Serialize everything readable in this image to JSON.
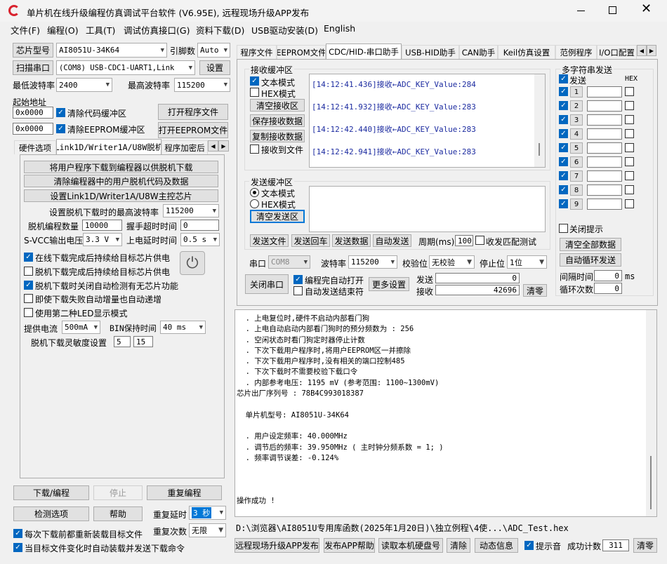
{
  "window": {
    "title": "单片机在线升级编程仿真调试平台软件 (V6.95E), 远程现场升级APP发布",
    "minimize_icon": "minimize-icon",
    "maximize_icon": "maximize-icon",
    "close_icon": "close-icon"
  },
  "menu": [
    "文件(F)",
    "编程(O)",
    "工具(T)",
    "调试仿真接口(G)",
    "资料下载(D)",
    "USB驱动安装(D)",
    "English"
  ],
  "left": {
    "chip_type_button": "芯片型号",
    "chip_type_value": "AI8051U-34K64",
    "pin_count_label": "引脚数",
    "pin_count_value": "Auto",
    "scan_port_button": "扫描串口",
    "port_value": "(COM8) USB-CDC1-UART1,Link",
    "settings_button": "设置",
    "min_baud_label": "最低波特率",
    "min_baud_value": "2400",
    "max_baud_label": "最高波特率",
    "max_baud_value": "115200",
    "start_addr_label": "起始地址",
    "code_addr_value": "0x0000",
    "clear_code_label": "清除代码缓冲区",
    "open_program_button": "打开程序文件",
    "eeprom_addr_value": "0x0000",
    "clear_eeprom_label": "清除EEPROM缓冲区",
    "open_eeprom_button": "打开EEPROM文件",
    "tabs": [
      "硬件选项",
      "Link1D/Writer1A/U8W脱机",
      "程序加密后"
    ],
    "offline": {
      "btn1": "将用户程序下载到编程器以供脱机下载",
      "btn2": "清除编程器中的用户脱机代码及数据",
      "btn3": "设置Link1D/Writer1A/U8W主控芯片",
      "max_baud_label": "设置脱机下载时的最高波特率",
      "max_baud_value": "115200",
      "count_label": "脱机编程数量",
      "count_value": "10000",
      "handshake_label": "握手超时时间",
      "handshake_value": "0",
      "svcc_label": "S-VCC输出电压",
      "svcc_value": "3.3 V",
      "power_delay_label": "上电延时时间",
      "power_delay_value": "0.5 s",
      "cb1": "在线下载完成后持续给目标芯片供电",
      "cb2": "脱机下载完成后持续给目标芯片供电",
      "cb3": "脱机下载时关闭自动检测有无芯片功能",
      "cb4": "即使下载失败自动增量也自动递增",
      "cb5": "使用第二种LED显示模式",
      "supply_label": "提供电流",
      "supply_value": "500mA",
      "bin_hold_label": "BIN保持时间",
      "bin_hold_value": "40 ms",
      "sensitivity_label": "脱机下载灵敏度设置",
      "sens1": "5",
      "sens2": "15",
      "power_icon": "power-icon"
    },
    "download_button": "下载/编程",
    "stop_button": "停止",
    "reprogram_button": "重复编程",
    "check_options_button": "检测选项",
    "help_button": "帮助",
    "repeat_delay_label": "重复延时",
    "repeat_delay_value": "3 秒",
    "repeat_count_label": "重复次数",
    "repeat_count_value": "无限",
    "reload_label": "每次下载前都重新装载目标文件",
    "auto_send_label": "当目标文件变化时自动装载并发送下载命令"
  },
  "right": {
    "tabs": [
      "程序文件",
      "EEPROM文件",
      "CDC/HID-串口助手",
      "USB-HID助手",
      "CAN助手",
      "Keil仿真设置",
      "范例程序",
      "I/O口配置"
    ],
    "recv": {
      "title": "接收缓冲区",
      "text_mode": "文本模式",
      "hex_mode": "HEX模式",
      "clear_button": "清空接收区",
      "save_button": "保存接收数据",
      "copy_button": "复制接收数据",
      "to_file": "接收到文件",
      "lines": [
        "[14:12:41.436]接收←ADC_KEY_Value:284",
        "[14:12:41.932]接收←ADC_KEY_Value:283",
        "[14:12:42.440]接收←ADC_KEY_Value:283",
        "[14:12:42.941]接收←ADC_KEY_Value:283"
      ]
    },
    "send": {
      "title": "发送缓冲区",
      "text_mode": "文本模式",
      "hex_mode": "HEX模式",
      "clear_button": "清空发送区",
      "send_file": "发送文件",
      "send_enter": "发送回车",
      "send_data": "发送数据",
      "auto_send": "自动发送",
      "period_label": "周期(ms)",
      "period_value": "100",
      "match_label": "收发匹配测试"
    },
    "multi": {
      "title": "多字符串发送",
      "send_label": "发送",
      "hex_label": "HEX",
      "rows": [
        "1",
        "2",
        "3",
        "4",
        "5",
        "6",
        "7",
        "8",
        "9"
      ],
      "close_tip": "关闭提示",
      "clear_all": "清空全部数据",
      "auto_cycle": "自动循环发送",
      "interval_label": "间隔时间",
      "interval_value": "0",
      "interval_unit": "ms",
      "cycle_label": "循环次数",
      "cycle_value": "0"
    },
    "port": {
      "port_label": "串口",
      "port_value": "COM8",
      "baud_label": "波特率",
      "baud_value": "115200",
      "parity_label": "校验位",
      "parity_value": "无校验",
      "stop_label": "停止位",
      "stop_value": "1位",
      "close_port": "关闭串口",
      "auto_open": "编程完自动打开",
      "auto_end": "自动发送结束符",
      "more_settings": "更多设置",
      "send_label": "发送",
      "send_count": "0",
      "recv_label": "接收",
      "recv_count": "42696",
      "clear_button": "清零"
    },
    "output_lines": [
      "  . 上电复位时,硬件不启动内部看门狗",
      "  . 上电自动启动内部看门狗时的预分频数为 : 256",
      "  . 空闲状态时看门狗定时器停止计数",
      "  . 下次下载用户程序时,将用户EEPROM区一并擦除",
      "  . 下次下载用户程序时,没有相关的端口控制485",
      "  . 下次下载时不需要校验下载口令",
      "  . 内部参考电压: 1195 mV (参考范围: 1100~1300mV)",
      "芯片出厂序列号 : 78B4C993018387",
      "",
      "  单片机型号: AI8051U-34K64",
      "",
      "  . 用户设定频率: 40.000MHz",
      "  . 调节后的频率: 39.950MHz ( 主时钟分频系数 = 1; )",
      "  . 频率调节误差: -0.124%",
      "",
      "",
      "",
      "操作成功 !"
    ],
    "file_path": "D:\\浏览器\\AI8051U专用库函数(2025年1月20日)\\独立例程\\4使...\\ADC_Test.hex",
    "bottom": {
      "publish_button": "远程现场升级APP发布",
      "publish_help": "发布APP帮助",
      "read_hdd": "读取本机硬盘号",
      "clear": "清除",
      "dynamic_info": "动态信息",
      "beep_label": "提示音",
      "success_label": "成功计数",
      "success_count": "311",
      "reset": "清零"
    }
  }
}
